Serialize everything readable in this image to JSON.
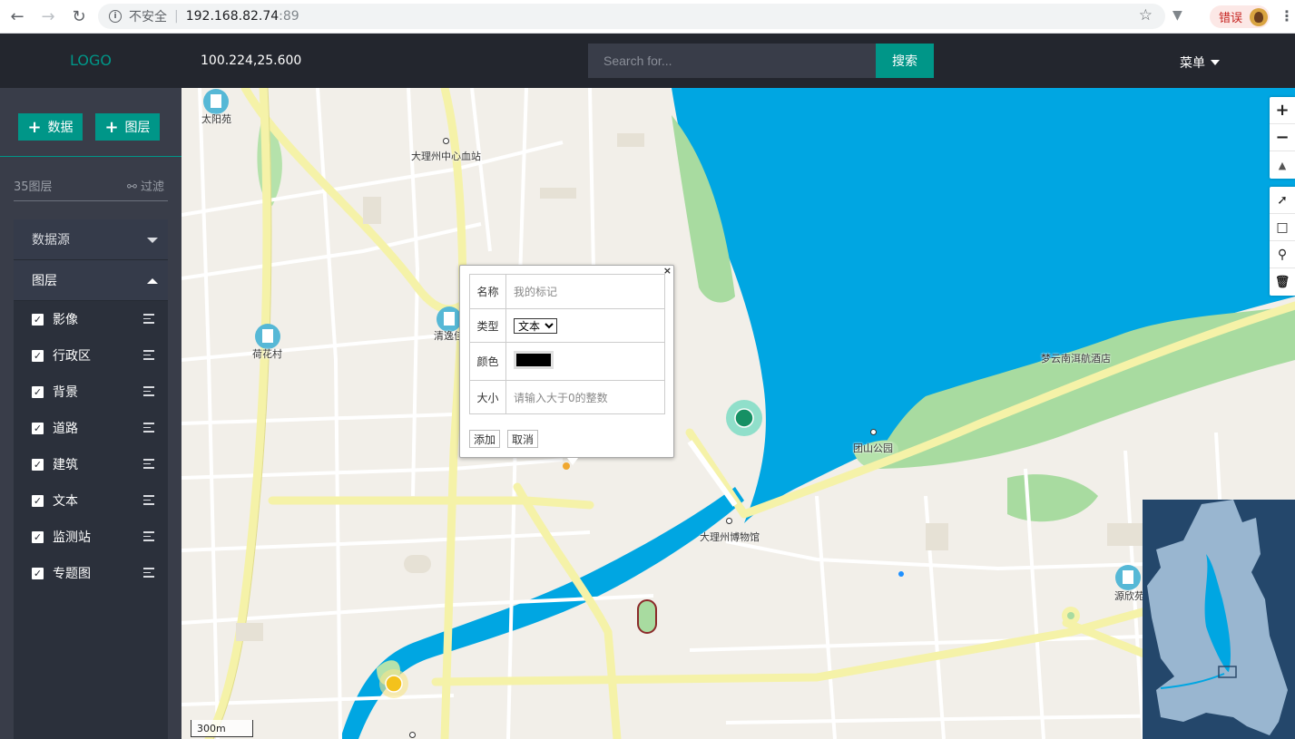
{
  "browser": {
    "security_label": "不安全",
    "url_host": "192.168.82.74",
    "url_port": ":89",
    "error_label": "错误"
  },
  "header": {
    "logo": "LOGO",
    "coords": "100.224,25.600",
    "search_placeholder": "Search for...",
    "search_button": "搜索",
    "menu_label": "菜单"
  },
  "sidebar": {
    "add_data": "数据",
    "add_layer": "图层",
    "layer_count": "35图层",
    "filter": "过滤",
    "datasource_title": "数据源",
    "layers_title": "图层",
    "layers": [
      {
        "label": "影像",
        "checked": true
      },
      {
        "label": "行政区",
        "checked": true
      },
      {
        "label": "背景",
        "checked": true
      },
      {
        "label": "道路",
        "checked": true
      },
      {
        "label": "建筑",
        "checked": true
      },
      {
        "label": "文本",
        "checked": true
      },
      {
        "label": "监测站",
        "checked": true
      },
      {
        "label": "专题图",
        "checked": true
      }
    ]
  },
  "map": {
    "pois": {
      "taiyangyuan": "太阳苑",
      "blood_station": "大理州中心血站",
      "hehuacun": "荷花村",
      "qingyi": "清逸佳",
      "mengyun_hotel": "梦云南洱航酒店",
      "tuanshan_park": "团山公园",
      "museum": "大理州博物馆",
      "yuanxinyuan": "源欣苑"
    },
    "scale_label": "300m",
    "colors": {
      "water": "#00a6e2",
      "land": "#f2efe9",
      "road": "#f5f2a8",
      "park": "#a8dba0",
      "accent": "#009688"
    }
  },
  "popup": {
    "fields": {
      "name_label": "名称",
      "name_placeholder": "我的标记",
      "type_label": "类型",
      "type_value": "文本",
      "color_label": "颜色",
      "color_value": "#000000",
      "size_label": "大小",
      "size_placeholder": "请输入大于0的整数"
    },
    "add_button": "添加",
    "cancel_button": "取消",
    "close": "×"
  },
  "tools": {
    "icons": [
      "zoom-in-icon",
      "zoom-out-icon",
      "north-arrow-icon",
      "draw-line-icon",
      "draw-polygon-icon",
      "draw-marker-icon",
      "delete-icon"
    ]
  }
}
